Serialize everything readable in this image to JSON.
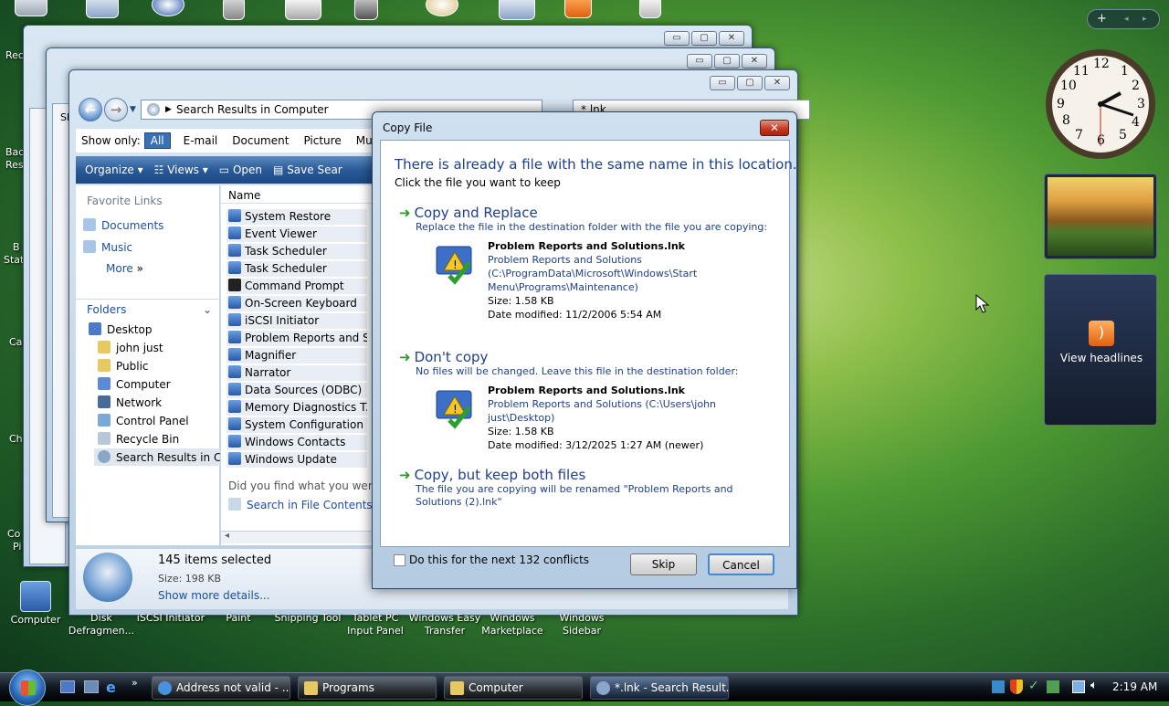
{
  "desktop": {
    "left_edge_labels": [
      "Rec",
      "Bac",
      "Res",
      "B",
      "Stati",
      "Ca",
      "Ch",
      "Co",
      "Pi"
    ],
    "bottom_icons": [
      {
        "label": "Computer"
      },
      {
        "label": "Disk Defragmen..."
      },
      {
        "label": "iSCSI Initiator"
      },
      {
        "label": "Paint"
      },
      {
        "label": "Snipping Tool"
      },
      {
        "label": "Tablet PC Input Panel"
      },
      {
        "label": "Windows Easy Transfer"
      },
      {
        "label": "Windows Marketplace"
      },
      {
        "label": "Windows Sidebar"
      }
    ]
  },
  "back_windows": [
    {
      "address_fragment": "Sh"
    }
  ],
  "explorer": {
    "address": "Search Results in Computer",
    "search_value": "*.lnk",
    "show_only": {
      "label": "Show only:",
      "filters": [
        "All",
        "E-mail",
        "Document",
        "Picture",
        "Mus"
      ]
    },
    "toolbar": {
      "organize": "Organize",
      "views": "Views",
      "open": "Open",
      "save_search": "Save Sear"
    },
    "favorite_links": {
      "header": "Favorite Links",
      "items": [
        "Documents",
        "Music"
      ],
      "more": "More"
    },
    "folders": {
      "header": "Folders",
      "items": [
        "Desktop",
        "john just",
        "Public",
        "Computer",
        "Network",
        "Control Panel",
        "Recycle Bin",
        "Search Results in Cor"
      ]
    },
    "column_name": "Name",
    "files": [
      "System Restore",
      "Event Viewer",
      "Task Scheduler",
      "Task Scheduler",
      "Command Prompt",
      "On-Screen Keyboard",
      "iSCSI Initiator",
      "Problem Reports and S...",
      "Magnifier",
      "Narrator",
      "Data Sources (ODBC)",
      "Memory Diagnostics T...",
      "System Configuration",
      "Windows Contacts",
      "Windows Update"
    ],
    "found_prompt": "Did you find what you were se",
    "search_file_contents": "Search in File Contents",
    "details": {
      "selected": "145 items selected",
      "size": "Size: 198 KB",
      "more_details": "Show more details..."
    }
  },
  "dialog": {
    "title": "Copy File",
    "heading": "There is already a file with the same name in this location.",
    "subheading": "Click the file you want to keep",
    "options": [
      {
        "title": "Copy and Replace",
        "desc": "Replace the file in the destination folder with the file you are copying:",
        "file": {
          "name": "Problem Reports and Solutions.lnk",
          "path": "Problem Reports and Solutions (C:\\ProgramData\\Microsoft\\Windows\\Start Menu\\Programs\\Maintenance)",
          "size": "Size: 1.58 KB",
          "modified": "Date modified: 11/2/2006 5:54 AM"
        }
      },
      {
        "title": "Don't copy",
        "desc": "No files will be changed. Leave this file in the destination folder:",
        "file": {
          "name": "Problem Reports and Solutions.lnk",
          "path": "Problem Reports and Solutions (C:\\Users\\john just\\Desktop)",
          "size": "Size: 1.58 KB",
          "modified": "Date modified: 3/12/2025 1:27 AM (newer)"
        }
      },
      {
        "title": "Copy, but keep both files",
        "desc": "The file you are copying will be renamed \"Problem Reports and Solutions (2).lnk\""
      }
    ],
    "checkbox_label": "Do this for the next 132 conflicts",
    "skip": "Skip",
    "cancel": "Cancel"
  },
  "sidebar": {
    "feed_label": "View headlines",
    "clock_numbers": [
      "12",
      "1",
      "2",
      "3",
      "4",
      "5",
      "6",
      "7",
      "8",
      "9",
      "10",
      "11"
    ]
  },
  "taskbar": {
    "buttons": [
      "Address not valid - ...",
      "Programs",
      "Computer",
      "*.lnk - Search Result..."
    ],
    "clock": "2:19 AM"
  }
}
